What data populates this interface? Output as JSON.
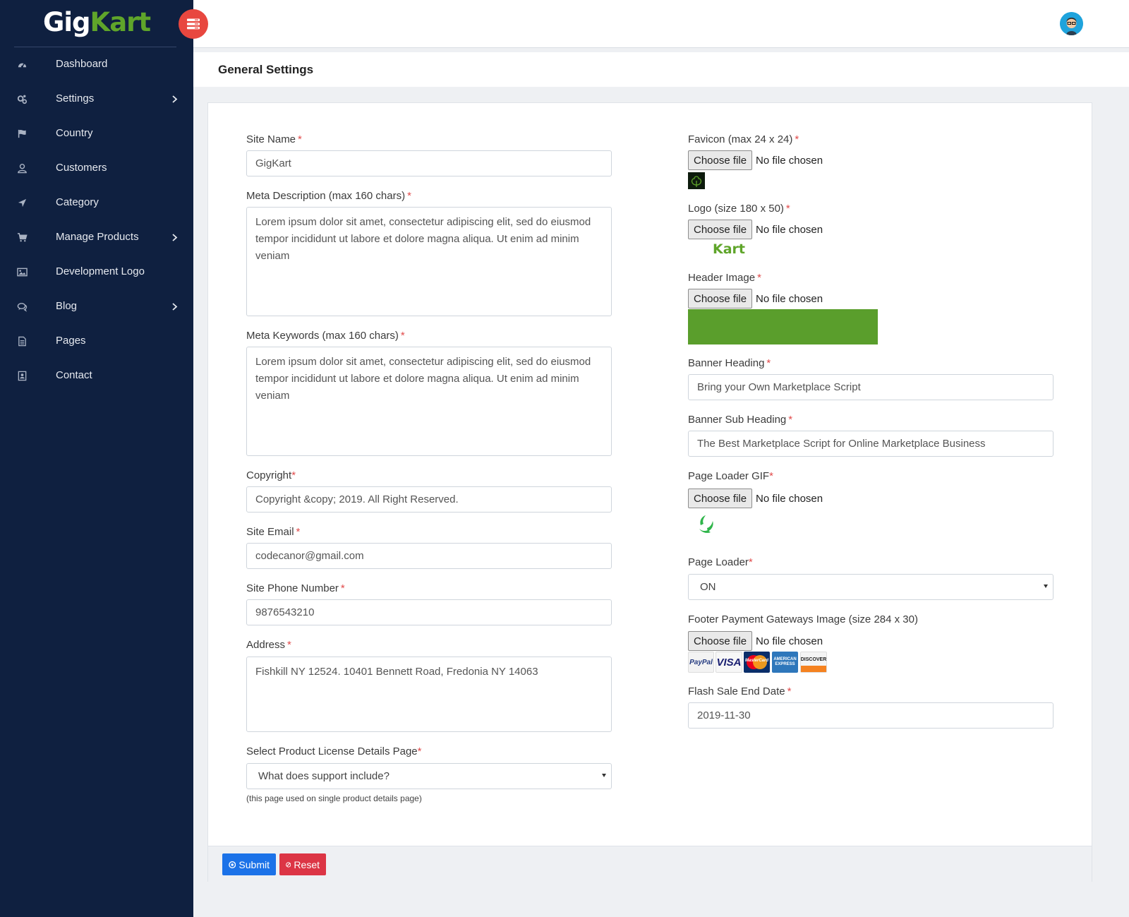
{
  "brand": {
    "part1": "Gig",
    "part2": "Kart"
  },
  "sidebar": {
    "items": [
      {
        "label": "Dashboard",
        "icon": "dashboard-icon"
      },
      {
        "label": "Settings",
        "icon": "settings-icon",
        "has_submenu": true
      },
      {
        "label": "Country",
        "icon": "flag-icon"
      },
      {
        "label": "Customers",
        "icon": "user-icon"
      },
      {
        "label": "Category",
        "icon": "location-arrow-icon"
      },
      {
        "label": "Manage Products",
        "icon": "cart-icon",
        "has_submenu": true
      },
      {
        "label": "Development Logo",
        "icon": "image-icon"
      },
      {
        "label": "Blog",
        "icon": "comments-icon",
        "has_submenu": true
      },
      {
        "label": "Pages",
        "icon": "file-icon"
      },
      {
        "label": "Contact",
        "icon": "contact-book-icon"
      }
    ]
  },
  "header": {
    "avatar": "user-avatar"
  },
  "page": {
    "title": "General Settings"
  },
  "form": {
    "site_name": {
      "label": "Site Name",
      "value": "GigKart"
    },
    "meta_description": {
      "label": "Meta Description (max 160 chars)",
      "value": "Lorem ipsum dolor sit amet, consectetur adipiscing elit, sed do eiusmod tempor incididunt ut labore et dolore magna aliqua. Ut enim ad minim veniam"
    },
    "meta_keywords": {
      "label": "Meta Keywords (max 160 chars)",
      "value": "Lorem ipsum dolor sit amet, consectetur adipiscing elit, sed do eiusmod tempor incididunt ut labore et dolore magna aliqua. Ut enim ad minim veniam"
    },
    "copyright": {
      "label": "Copyright",
      "value": "Copyright &copy; 2019. All Right Reserved."
    },
    "site_email": {
      "label": "Site Email",
      "value": "codecanor@gmail.com"
    },
    "site_phone": {
      "label": "Site Phone Number",
      "value": "9876543210"
    },
    "address": {
      "label": "Address",
      "value": "Fishkill NY 12524. 10401 Bennett Road, Fredonia NY 14063"
    },
    "license_page": {
      "label": "Select Product License Details Page",
      "value": "What does support include?",
      "help": "(this page used on single product details page)"
    },
    "favicon": {
      "label": "Favicon (max 24 x 24)"
    },
    "logo": {
      "label": "Logo (size 180 x 50)",
      "preview_text": "Kart"
    },
    "header_image": {
      "label": "Header Image"
    },
    "banner_heading": {
      "label": "Banner Heading",
      "value": "Bring your Own Marketplace Script"
    },
    "banner_sub_heading": {
      "label": "Banner Sub Heading",
      "value": "The Best Marketplace Script for Online Marketplace Business"
    },
    "page_loader_gif": {
      "label": "Page Loader GIF"
    },
    "page_loader": {
      "label": "Page Loader",
      "value": "ON"
    },
    "footer_payment": {
      "label": "Footer Payment Gateways Image (size 284 x 30)",
      "cards": [
        "PayPal",
        "VISA",
        "MasterCard",
        "AMERICAN EXPRESS",
        "DISCOVER"
      ]
    },
    "flash_sale": {
      "label": "Flash Sale End Date",
      "value": "2019-11-30"
    },
    "file_button": "Choose file",
    "file_status": "No file chosen",
    "required_mark": "*"
  },
  "actions": {
    "submit": "Submit",
    "reset": "Reset"
  },
  "colors": {
    "sidebar": "#0f2040",
    "accent_green": "#5fa52a",
    "toggle": "#e8473f",
    "submit": "#1b72e8",
    "reset": "#dc3545"
  }
}
